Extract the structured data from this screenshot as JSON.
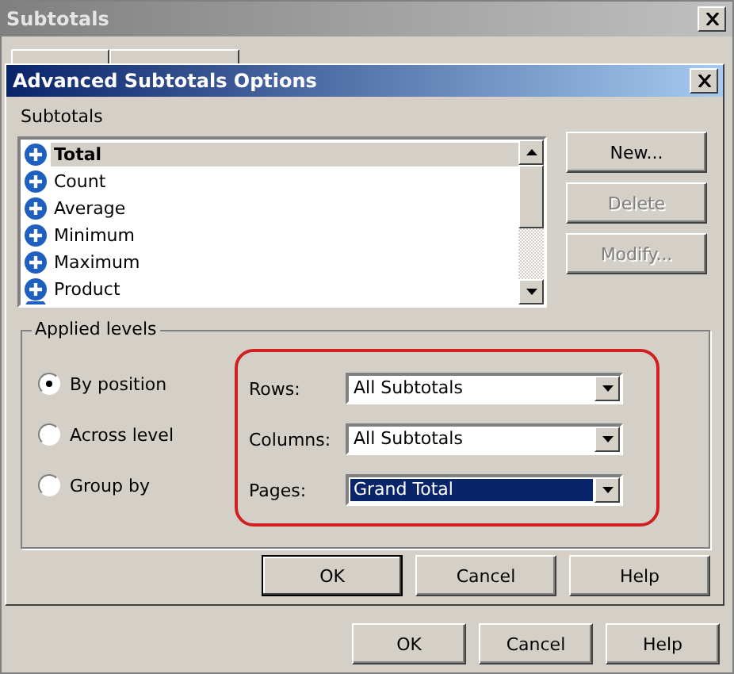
{
  "back_window": {
    "title": "Subtotals",
    "buttons": [
      "OK",
      "Cancel",
      "Help"
    ]
  },
  "dialog": {
    "title": "Advanced Subtotals Options",
    "list_label": "Subtotals",
    "items": [
      {
        "label": "Total",
        "selected": true
      },
      {
        "label": "Count",
        "selected": false
      },
      {
        "label": "Average",
        "selected": false
      },
      {
        "label": "Minimum",
        "selected": false
      },
      {
        "label": "Maximum",
        "selected": false
      },
      {
        "label": "Product",
        "selected": false
      }
    ],
    "side_buttons": [
      {
        "label": "New...",
        "disabled": false
      },
      {
        "label": "Delete",
        "disabled": true
      },
      {
        "label": "Modify...",
        "disabled": true
      }
    ],
    "group_title": "Applied levels",
    "radios": [
      {
        "label": "By position",
        "selected": true
      },
      {
        "label": "Across level",
        "selected": false
      },
      {
        "label": "Group by",
        "selected": false
      }
    ],
    "selects": [
      {
        "label": "Rows:",
        "value": "All Subtotals",
        "focused": false
      },
      {
        "label": "Columns:",
        "value": "All Subtotals",
        "focused": false
      },
      {
        "label": "Pages:",
        "value": "Grand Total",
        "focused": true
      }
    ],
    "buttons": [
      "OK",
      "Cancel",
      "Help"
    ]
  }
}
